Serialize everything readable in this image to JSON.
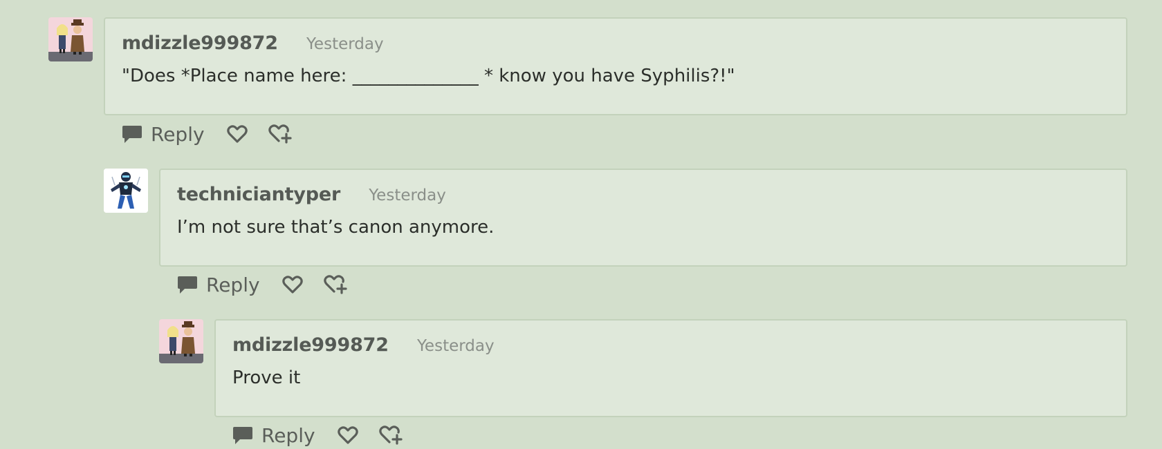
{
  "comments": [
    {
      "username": "mdizzle999872",
      "timestamp": "Yesterday",
      "body": "\"Does *Place name here: ______________ * know you have Syphilis?!\"",
      "reply_label": "Reply"
    },
    {
      "username": "techniciantyper",
      "timestamp": "Yesterday",
      "body": "I’m not sure that’s canon anymore.",
      "reply_label": "Reply"
    },
    {
      "username": "mdizzle999872",
      "timestamp": "Yesterday",
      "body": "Prove it",
      "reply_label": "Reply"
    }
  ],
  "colors": {
    "background": "#d3dfcc",
    "card": "#dfe8da",
    "card_border": "#c3d2bb",
    "username": "#555a55",
    "timestamp": "#8a8f89",
    "icon": "#5a5e59"
  }
}
